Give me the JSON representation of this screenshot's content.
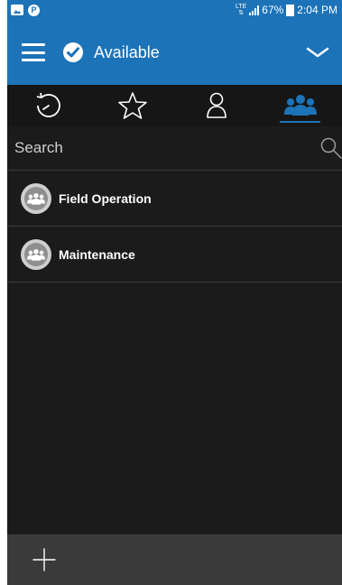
{
  "status_bar": {
    "network": "LTE",
    "battery": "67%",
    "time": "2:04 PM",
    "icons": [
      "image-icon",
      "parking-icon",
      "signal-icon",
      "battery-icon"
    ]
  },
  "app_bar": {
    "status_label": "Available",
    "icons": [
      "menu-icon",
      "check-circle-icon",
      "chevron-down-icon"
    ]
  },
  "tabs": [
    {
      "name": "recent",
      "icon": "history-icon",
      "active": false
    },
    {
      "name": "favorites",
      "icon": "star-icon",
      "active": false
    },
    {
      "name": "contacts",
      "icon": "person-icon",
      "active": false
    },
    {
      "name": "groups",
      "icon": "group-icon",
      "active": true
    }
  ],
  "search": {
    "placeholder": "Search",
    "value": ""
  },
  "groups": [
    {
      "name": "Field Operation",
      "icon": "group-avatar-icon"
    },
    {
      "name": "Maintenance",
      "icon": "group-avatar-icon"
    }
  ],
  "bottom_bar": {
    "icons": [
      "plus-icon"
    ]
  },
  "colors": {
    "primary": "#1d73b8",
    "background": "#1b1b1b",
    "tab_background": "#161616",
    "bottom_bar": "#3a3a3a",
    "text": "#ffffff"
  }
}
